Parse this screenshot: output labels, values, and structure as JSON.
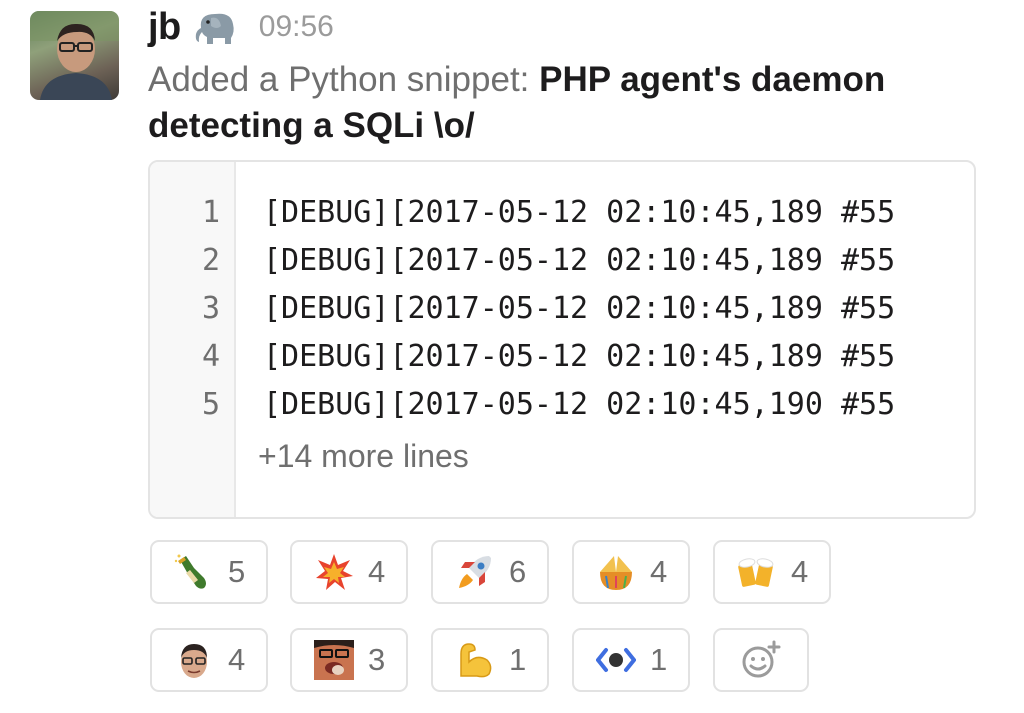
{
  "message": {
    "username": "jb",
    "status_emoji": "elephant-icon",
    "timestamp": "09:56",
    "prefix": "Added a Python snippet:",
    "snippet_title": "PHP agent's daemon detecting a SQLi \\o/"
  },
  "snippet": {
    "lines": [
      {
        "num": "1",
        "text": "[DEBUG][2017-05-12 02:10:45,189 #55"
      },
      {
        "num": "2",
        "text": "[DEBUG][2017-05-12 02:10:45,189 #55"
      },
      {
        "num": "3",
        "text": "[DEBUG][2017-05-12 02:10:45,189 #55"
      },
      {
        "num": "4",
        "text": "[DEBUG][2017-05-12 02:10:45,189 #55"
      },
      {
        "num": "5",
        "text": "[DEBUG][2017-05-12 02:10:45,190 #55"
      }
    ],
    "more_lines": "+14 more lines"
  },
  "reactions": [
    {
      "icon": "champagne-icon",
      "count": "5"
    },
    {
      "icon": "collision-icon",
      "count": "4"
    },
    {
      "icon": "rocket-icon",
      "count": "6"
    },
    {
      "icon": "confetti-ball-icon",
      "count": "4"
    },
    {
      "icon": "beers-icon",
      "count": "4"
    },
    {
      "icon": "custom-face-icon",
      "count": "4"
    },
    {
      "icon": "custom-eating-face-icon",
      "count": "3"
    },
    {
      "icon": "flexed-biceps-icon",
      "count": "1"
    },
    {
      "icon": "custom-code-eye-icon",
      "count": "1"
    }
  ],
  "add_reaction_icon": "add-reaction-icon"
}
